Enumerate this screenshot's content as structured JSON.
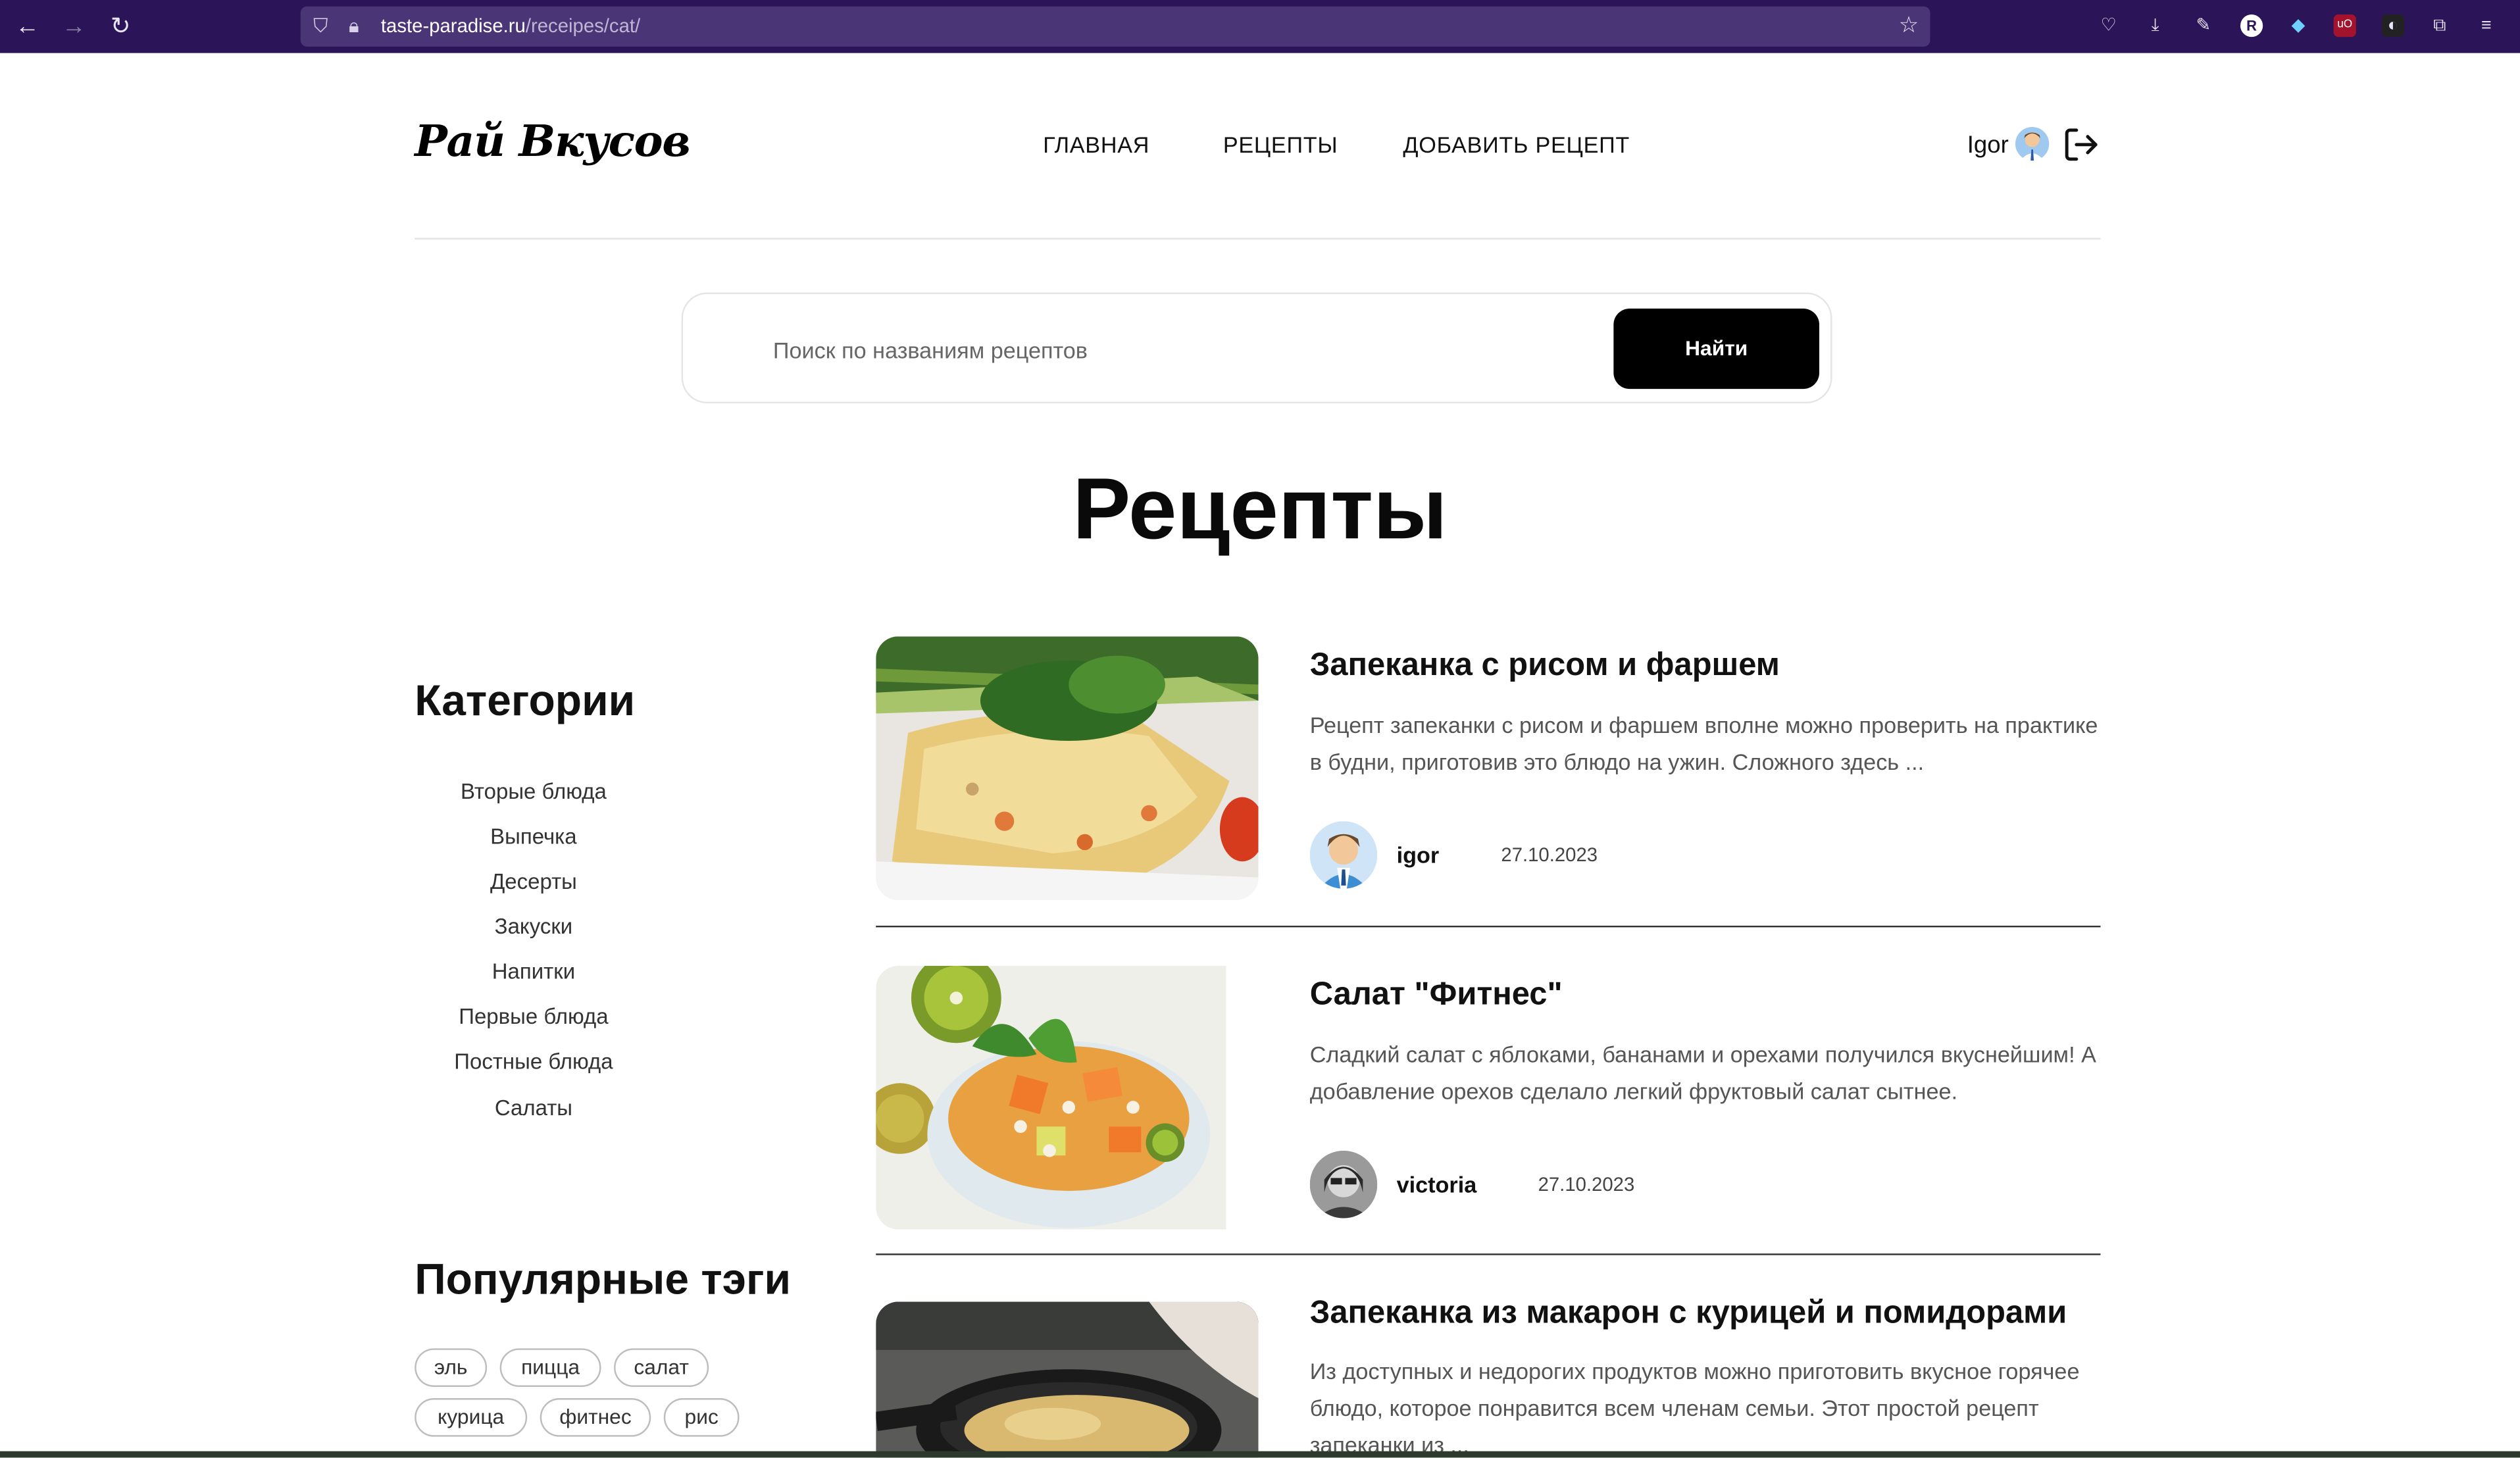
{
  "browser": {
    "url_host": "taste-paradise.ru",
    "url_path": "/receipes/cat/"
  },
  "header": {
    "logo": "Рай Вкусов",
    "nav": [
      "ГЛАВНАЯ",
      "РЕЦЕПТЫ",
      "ДОБАВИТЬ РЕЦЕПТ"
    ],
    "username": "Igor"
  },
  "search": {
    "placeholder": "Поиск по названиям рецептов",
    "button": "Найти"
  },
  "page_title": "Рецепты",
  "sidebar": {
    "categories_title": "Категории",
    "categories": [
      "Вторые блюда",
      "Выпечка",
      "Десерты",
      "Закуски",
      "Напитки",
      "Первые блюда",
      "Постные блюда",
      "Салаты"
    ],
    "tags_title": "Популярные тэги",
    "tags": [
      "эль",
      "пицца",
      "салат",
      "курица",
      "фитнес",
      "рис"
    ]
  },
  "recipes": [
    {
      "title": "Запеканка с рисом и фаршем",
      "desc_lines": [
        "Рецепт запеканки с рисом и фаршем вполне можно проверить на практике",
        "в будни, приготовив это блюдо на ужин. Сложного здесь ..."
      ],
      "author": "igor",
      "date": "27.10.2023"
    },
    {
      "title": "Салат \"Фитнес\"",
      "desc_lines": [
        "Сладкий салат с яблоками, бананами и орехами получился вкуснейшим! А",
        "добавление орехов сделало легкий фруктовый салат сытнее."
      ],
      "author": "victoria",
      "date": "27.10.2023"
    },
    {
      "title": "Запеканка из макарон с курицей и помидорами",
      "desc_lines": [
        "Из доступных и недорогих продуктов можно приготовить вкусное горячее",
        "блюдо, которое понравится всем членам семьи. Этот простой рецепт",
        "запеканки из ..."
      ]
    }
  ]
}
